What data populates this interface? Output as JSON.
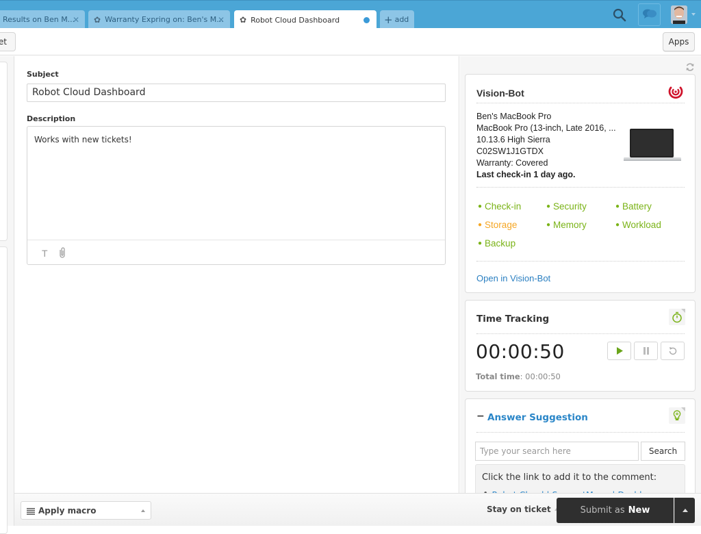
{
  "tabs": [
    {
      "label": "Results on Ben M...",
      "icon": "none",
      "closable": true,
      "active": false
    },
    {
      "label": "Warranty Expring on: Ben's M...",
      "icon": "gear-icon",
      "closable": true,
      "active": false
    },
    {
      "label": "Robot Cloud Dashboard",
      "icon": "gear-icon",
      "closable": false,
      "active": true,
      "unsaved_dot": true
    }
  ],
  "add_tab_label": "add",
  "header": {
    "search_icon": "search-icon",
    "chat_icon": "chat-bubbles-icon",
    "avatar": "user-avatar"
  },
  "toolbar": {
    "left_button_label": "et",
    "apps_label": "Apps"
  },
  "ticket": {
    "subject_label": "Subject",
    "subject_value": "Robot Cloud Dashboard",
    "description_label": "Description",
    "description_value": "Works with new tickets!",
    "format_icon_glyph": "T"
  },
  "visionbot": {
    "title": "Vision-Bot",
    "device_name": "Ben's MacBook Pro",
    "model": "MacBook Pro (13-inch, Late 2016, ...",
    "os": "10.13.6 High Sierra",
    "serial": "C02SW1J1GTDX",
    "warranty": "Warranty: Covered",
    "last_checkin": "Last check-in 1 day ago.",
    "statuses": [
      {
        "label": "Check-in",
        "state": "ok"
      },
      {
        "label": "Security",
        "state": "ok"
      },
      {
        "label": "Battery",
        "state": "ok"
      },
      {
        "label": "Storage",
        "state": "warning"
      },
      {
        "label": "Memory",
        "state": "ok"
      },
      {
        "label": "Workload",
        "state": "ok"
      },
      {
        "label": "Backup",
        "state": "ok"
      }
    ],
    "status_colors": {
      "ok": "#7ab317",
      "warning": "#f5a623"
    },
    "open_link": "Open in Vision-Bot"
  },
  "time_tracking": {
    "title": "Time Tracking",
    "elapsed": "00:00:50",
    "total_label": "Total time",
    "total_value": ": 00:00:50"
  },
  "answer_suggestion": {
    "title": "Answer Suggestion",
    "search_placeholder": "Type your search here",
    "search_button": "Search",
    "hint": "Click the link to add it to the comment:",
    "first_result": "Robot Cloud | SupportMenu | Dashbo..."
  },
  "bottom": {
    "macro_label": "Apply macro",
    "stay_label": "Stay on ticket",
    "submit_prefix": "Submit as",
    "submit_status": "New"
  },
  "colors": {
    "topbar": "#4ba6d6",
    "link": "#2a86c8",
    "submit_bg": "#2f2f2f",
    "visionbot_red": "#d0142c"
  }
}
